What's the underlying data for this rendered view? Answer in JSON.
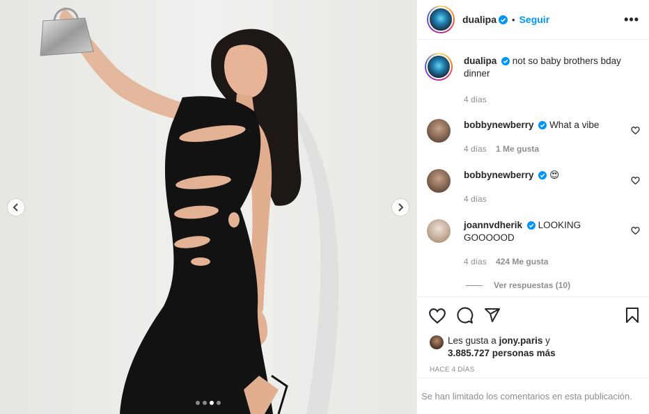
{
  "post": {
    "author": "dualipa",
    "follow_label": "Seguir",
    "separator": "•",
    "more_label": "•••",
    "caption": "not so baby brothers bday dinner",
    "caption_time": "4 días"
  },
  "comments": [
    {
      "user": "bobbynewberry",
      "text": "What a vibe",
      "time": "4 días",
      "likes": "1 Me gusta"
    },
    {
      "user": "bobbynewberry",
      "text": "😍",
      "time": "4 días",
      "likes": ""
    },
    {
      "user": "joannvdherik",
      "text": "LOOKING GOOOOOD",
      "time": "4 días",
      "likes": "424 Me gusta"
    }
  ],
  "view_replies": "Ver respuestas (10)",
  "likes": {
    "prefix": "Les gusta a ",
    "user": "jony.paris",
    "suffix": " y",
    "count_text": "3.885.727 personas más"
  },
  "posted_ago": "HACE 4 DÍAS",
  "comments_limited": "Se han limitado los comentarios en esta publicación.",
  "carousel": {
    "total": 4,
    "active_index": 3
  },
  "colors": {
    "accent": "#0095f6",
    "verified": "#0095f6",
    "muted": "#8e8e8e"
  }
}
